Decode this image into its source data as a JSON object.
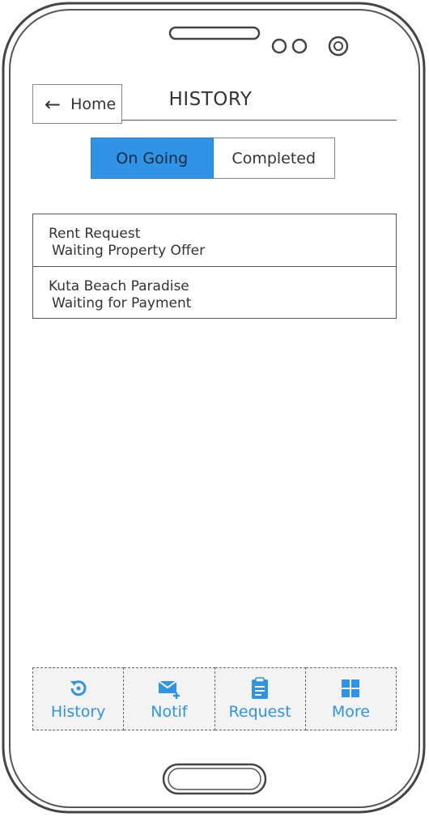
{
  "header": {
    "back_label": "Home",
    "title": "HISTORY"
  },
  "tabs": [
    {
      "label": "On Going",
      "active": true
    },
    {
      "label": "Completed",
      "active": false
    }
  ],
  "list": [
    {
      "title": "Rent Request",
      "status": "Waiting Property Offer"
    },
    {
      "title": "Kuta Beach Paradise",
      "status": "Waiting for Payment"
    }
  ],
  "bottom_nav": [
    {
      "label": "History",
      "icon": "history-icon"
    },
    {
      "label": "Notif",
      "icon": "mail-plus-icon"
    },
    {
      "label": "Request",
      "icon": "clipboard-icon"
    },
    {
      "label": "More",
      "icon": "grid-icon"
    }
  ],
  "colors": {
    "accent": "#2f93e6",
    "text": "#333333",
    "border": "#555555"
  }
}
